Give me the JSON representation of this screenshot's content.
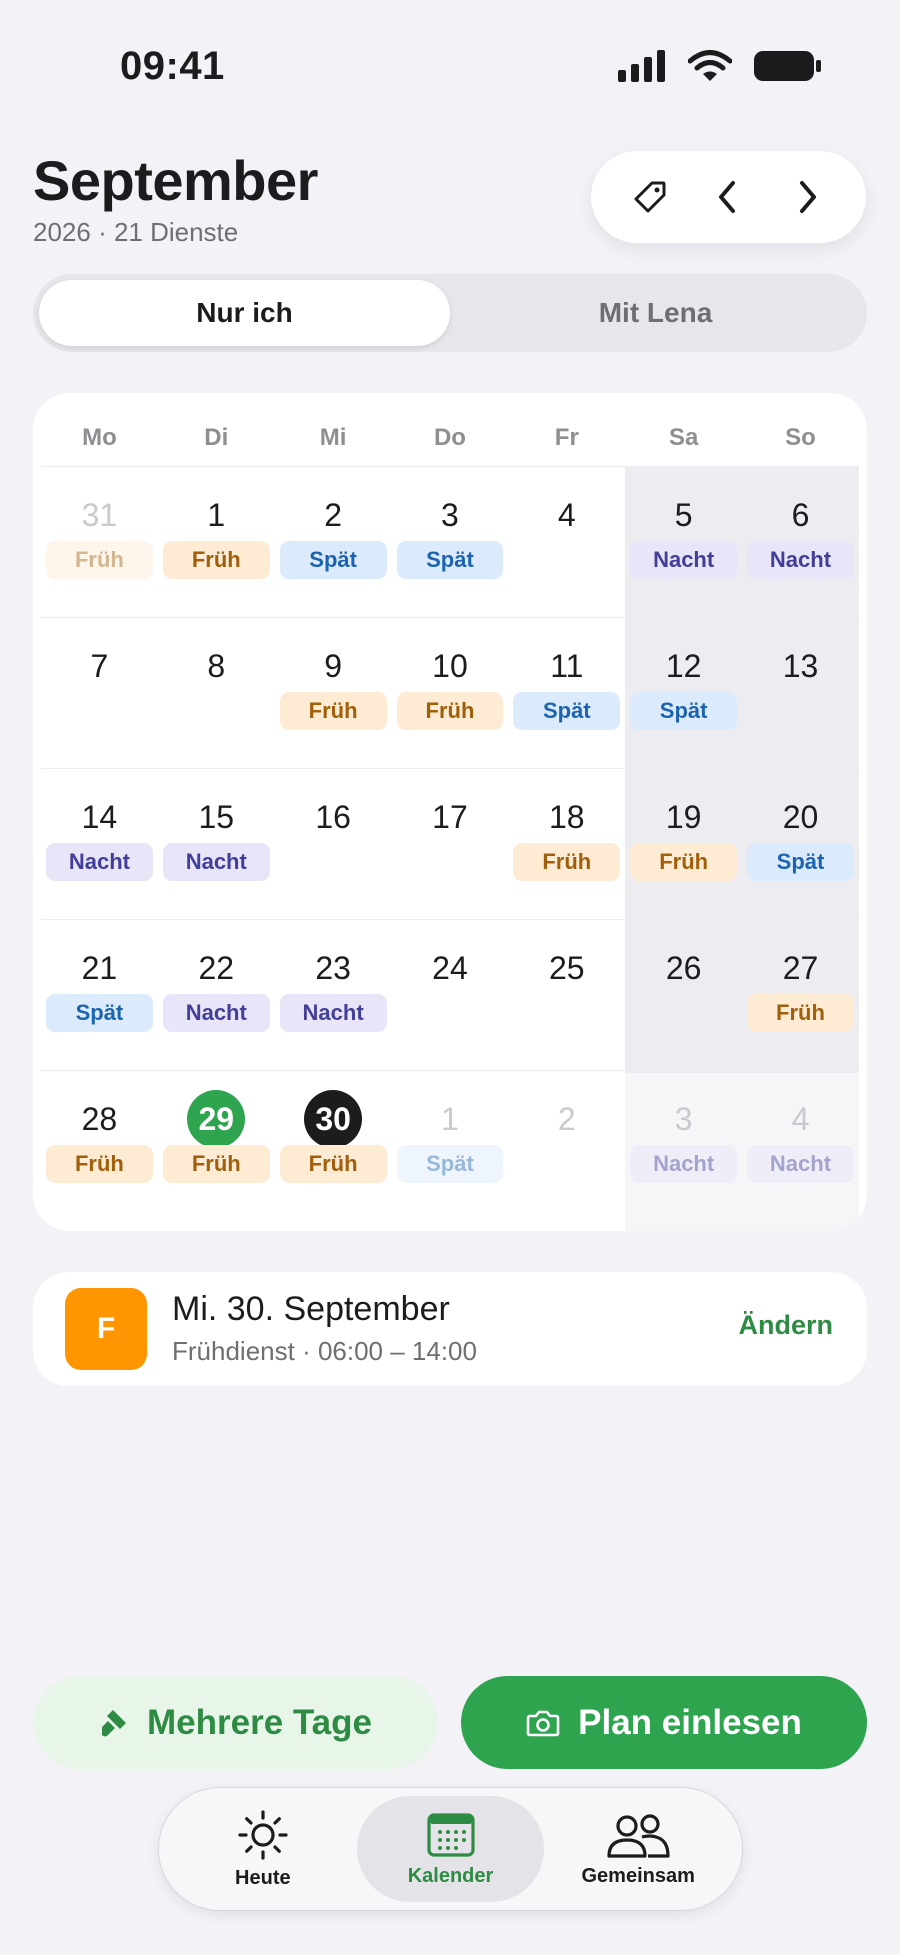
{
  "status_bar": {
    "time": "09:41",
    "icons": [
      "cellular-signal-icon",
      "wifi-icon",
      "battery-icon"
    ]
  },
  "header": {
    "title": "September",
    "subtitle": "2026 · 21 Dienste",
    "actions": [
      "tag-icon",
      "chevron-left-icon",
      "chevron-right-icon"
    ]
  },
  "segmented": {
    "options": [
      "Nur ich",
      "Mit Lena"
    ],
    "selected": "Nur ich"
  },
  "calendar": {
    "weekdays": [
      "Mo",
      "Di",
      "Mi",
      "Do",
      "Fr",
      "Sa",
      "So"
    ],
    "weeks": [
      [
        {
          "day": "31",
          "shift": "Früh",
          "type": "frueh",
          "muted": true
        },
        {
          "day": "1",
          "shift": "Früh",
          "type": "frueh"
        },
        {
          "day": "2",
          "shift": "Spät",
          "type": "spaet"
        },
        {
          "day": "3",
          "shift": "Spät",
          "type": "spaet"
        },
        {
          "day": "4",
          "shift": "",
          "type": ""
        },
        {
          "day": "5",
          "shift": "Nacht",
          "type": "nacht"
        },
        {
          "day": "6",
          "shift": "Nacht",
          "type": "nacht"
        }
      ],
      [
        {
          "day": "7",
          "shift": "",
          "type": ""
        },
        {
          "day": "8",
          "shift": "",
          "type": ""
        },
        {
          "day": "9",
          "shift": "Früh",
          "type": "frueh"
        },
        {
          "day": "10",
          "shift": "Früh",
          "type": "frueh"
        },
        {
          "day": "11",
          "shift": "Spät",
          "type": "spaet"
        },
        {
          "day": "12",
          "shift": "Spät",
          "type": "spaet"
        },
        {
          "day": "13",
          "shift": "",
          "type": ""
        }
      ],
      [
        {
          "day": "14",
          "shift": "Nacht",
          "type": "nacht"
        },
        {
          "day": "15",
          "shift": "Nacht",
          "type": "nacht"
        },
        {
          "day": "16",
          "shift": "",
          "type": ""
        },
        {
          "day": "17",
          "shift": "",
          "type": ""
        },
        {
          "day": "18",
          "shift": "Früh",
          "type": "frueh"
        },
        {
          "day": "19",
          "shift": "Früh",
          "type": "frueh"
        },
        {
          "day": "20",
          "shift": "Spät",
          "type": "spaet"
        }
      ],
      [
        {
          "day": "21",
          "shift": "Spät",
          "type": "spaet"
        },
        {
          "day": "22",
          "shift": "Nacht",
          "type": "nacht"
        },
        {
          "day": "23",
          "shift": "Nacht",
          "type": "nacht"
        },
        {
          "day": "24",
          "shift": "",
          "type": ""
        },
        {
          "day": "25",
          "shift": "",
          "type": ""
        },
        {
          "day": "26",
          "shift": "",
          "type": ""
        },
        {
          "day": "27",
          "shift": "Früh",
          "type": "frueh"
        }
      ],
      [
        {
          "day": "28",
          "shift": "Früh",
          "type": "frueh"
        },
        {
          "day": "29",
          "shift": "Früh",
          "type": "frueh",
          "highlight": "today"
        },
        {
          "day": "30",
          "shift": "Früh",
          "type": "frueh",
          "highlight": "selected"
        },
        {
          "day": "1",
          "shift": "Spät",
          "type": "spaet",
          "muted": true
        },
        {
          "day": "2",
          "shift": "",
          "type": "",
          "muted": true
        },
        {
          "day": "3",
          "shift": "Nacht",
          "type": "nacht",
          "muted": true
        },
        {
          "day": "4",
          "shift": "Nacht",
          "type": "nacht",
          "muted": true
        }
      ]
    ]
  },
  "detail": {
    "icon_letter": "F",
    "title": "Mi. 30. September",
    "subtitle": "Frühdienst · 06:00 – 14:00",
    "action": "Ändern"
  },
  "actions": {
    "multi_days": "Mehrere Tage",
    "multi_days_icon": "brush-icon",
    "scan_plan": "Plan einlesen",
    "scan_plan_icon": "camera-icon"
  },
  "tabbar": {
    "tabs": [
      {
        "label": "Heute",
        "icon": "sun-icon"
      },
      {
        "label": "Kalender",
        "icon": "calendar-icon",
        "active": true
      },
      {
        "label": "Gemeinsam",
        "icon": "people-icon"
      }
    ]
  },
  "colors": {
    "accent": "#2ea44f",
    "frueh": "#a0600b",
    "spaet": "#1d64b0",
    "nacht": "#423f9a",
    "detail_icon": "#ff9500"
  }
}
